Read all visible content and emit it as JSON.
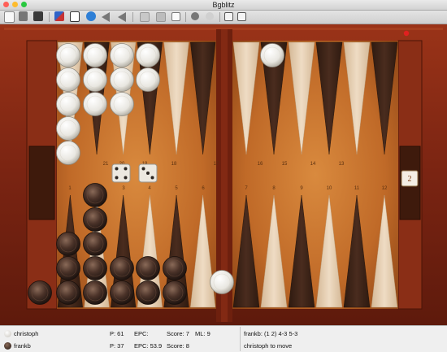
{
  "window": {
    "title": "Bgblitz"
  },
  "toolbar": {
    "icons": [
      "new-game-icon",
      "open-icon",
      "save-icon",
      "settings-icon",
      "import-icon",
      "undo-icon",
      "back-icon",
      "dice-icon",
      "board-icon",
      "resign-icon",
      "hint-icon",
      "analyze-icon",
      "cube-icon",
      "edit-icon"
    ]
  },
  "colors": {
    "board_wood": "#c8722e",
    "frame": "#7a2412",
    "dark_point": "#3d2317",
    "light_point": "#e4cdb2",
    "white_checker": "#f0efeb",
    "dark_checker": "#4a3a33"
  },
  "board": {
    "point_numbers_top": [
      "21",
      "20",
      "19",
      "18",
      "17",
      "16",
      "15",
      "14",
      "13"
    ],
    "point_numbers_bottom": [
      "1",
      "2",
      "3",
      "4",
      "5",
      "6",
      "7",
      "8",
      "9",
      "10",
      "11",
      "12"
    ],
    "dice": [
      4,
      3
    ],
    "cube_value": "2"
  },
  "players": [
    {
      "name": "christoph",
      "pips": "P: 61",
      "epc": "EPC:",
      "score": "Score: 7",
      "match_length": "ML: 9"
    },
    {
      "name": "frankb",
      "pips": "P: 37",
      "epc": "EPC: 53.9",
      "score": "Score: 8"
    }
  ],
  "status": {
    "last_move": "frankb: (1 2) 4-3 5-3",
    "to_move": "christoph to move"
  }
}
